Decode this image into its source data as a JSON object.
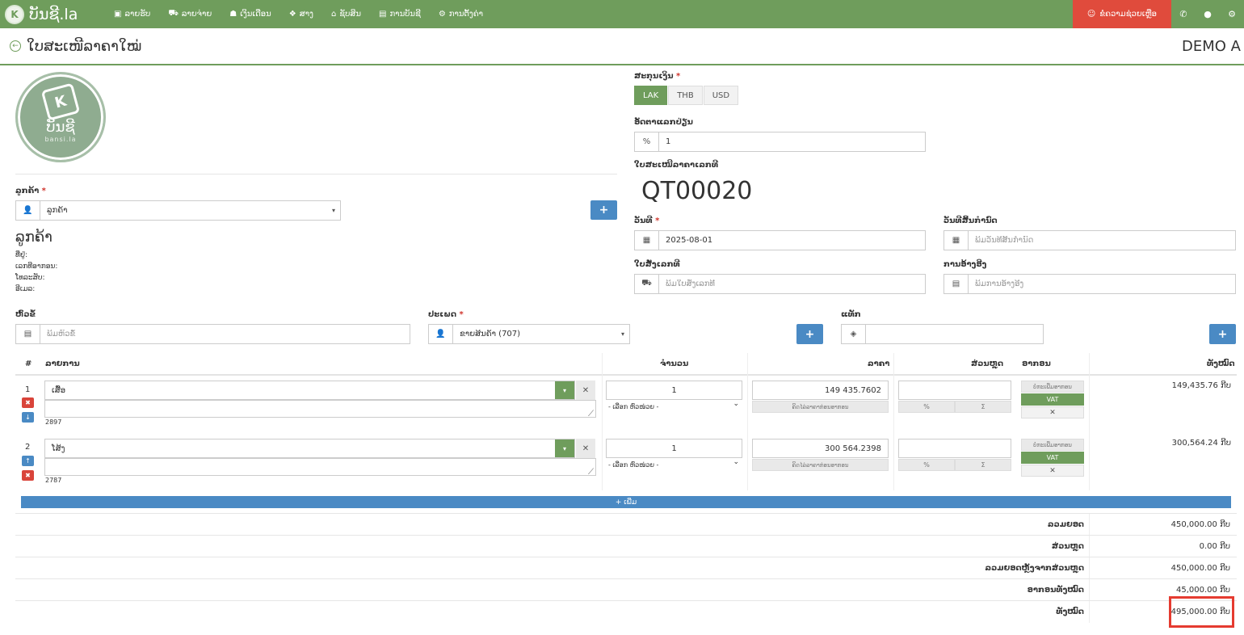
{
  "app": {
    "brand": "ບັນຊີ.la",
    "brand_logo": "K"
  },
  "nav": [
    {
      "icon": "money-icon",
      "glyph": "▣",
      "label": "ລາຍຮັບ"
    },
    {
      "icon": "cart-icon",
      "glyph": "⛟",
      "label": "ລາຍຈ່າຍ"
    },
    {
      "icon": "users-icon",
      "glyph": "☗",
      "label": "ເງິນເດືອນ"
    },
    {
      "icon": "cubes-icon",
      "glyph": "❖",
      "label": "ສາງ"
    },
    {
      "icon": "bank-icon",
      "glyph": "⌂",
      "label": "ຊັບສິນ"
    },
    {
      "icon": "book-icon",
      "glyph": "▤",
      "label": "ການບັນຊີ"
    },
    {
      "icon": "cogs-icon",
      "glyph": "⚙",
      "label": "ການຕັ້ງຄ່າ"
    }
  ],
  "support": {
    "label": "ຂໍຄວາມຊ່ວຍເຫຼືອ"
  },
  "page": {
    "title": "ໃບສະເໜີລາຄາໃໝ່",
    "company": "DEMO A"
  },
  "logo": {
    "name": "ບັນຊີ",
    "sub": "bansi.la"
  },
  "currency": {
    "label": "ສະກຸນເງິນ",
    "options": [
      "LAK",
      "THB",
      "USD"
    ],
    "selected": "LAK"
  },
  "exchange": {
    "label": "ອັດຕາແລກປ່ຽນ",
    "addon": "%",
    "value": "1"
  },
  "quote": {
    "label": "ໃບສະເໜີລາຄາເລກທີ",
    "number": "QT00020"
  },
  "customer": {
    "label": "ລູກຄ້າ",
    "select_value": "ລູກຄ້າ",
    "name": "ລູກຄ້າ",
    "address": "ທີ່ຢູ່:",
    "tax_id": "ເລກທີອາກອນ:",
    "phone": "ໂທລະສັບ:",
    "email": "ອີເມລ:"
  },
  "date": {
    "label": "ວັນທີ",
    "value": "2025-08-01"
  },
  "expiry": {
    "label": "ວັນທີສິ້ນກຳນົດ",
    "placeholder": "ພິມວັນທີສິ້ນກຳນົດ"
  },
  "po": {
    "label": "ໃບສັ່ງເລກທີ",
    "placeholder": "ພິມໃບສັ່ງເລກທີ"
  },
  "reference": {
    "label": "ການອ້າງອີງ",
    "placeholder": "ພິມການອ້າງອີງ"
  },
  "subject": {
    "label": "ຫົວຂໍ້",
    "placeholder": "ພິມຫົວຂໍ້"
  },
  "type": {
    "label": "ປະເພດ",
    "value": "ຂາຍສິນຄ້າ (707)"
  },
  "tags": {
    "label": "ແທັກ"
  },
  "table": {
    "headers": {
      "num": "#",
      "item": "ລາຍການ",
      "qty": "ຈຳນວນ",
      "price": "ລາຄາ",
      "discount": "ສ່ວນຫຼຸດ",
      "tax": "ອາກອນ",
      "total": "ທັງໝົດ"
    },
    "unit_placeholder": "- ເລືອກ ຫົວໜ່ວຍ -",
    "price_note": "ຄິດໄລ່ລາຄາກ່ອນອາກອນ",
    "disc_pct": "%",
    "disc_sum": "Σ",
    "tax_top": "ບໍ່ກະເພີ່ມອາກອນ",
    "tax_vat": "VAT",
    "rows": [
      {
        "num": "1",
        "name": "ເສື້ອ",
        "code": "2897",
        "qty": "1",
        "price": "149 435.7602",
        "total": "149,435.76 ກີບ"
      },
      {
        "num": "2",
        "name": "ໂສ້ງ",
        "code": "2787",
        "qty": "1",
        "price": "300 564.2398",
        "total": "300,564.24 ກີບ"
      }
    ],
    "add_label": "+ ເພີ່ມ"
  },
  "summary": [
    {
      "label": "ລວມຍອດ",
      "value": "450,000.00 ກີບ"
    },
    {
      "label": "ສ່ວນຫຼຸດ",
      "value": "0.00 ກີບ"
    },
    {
      "label": "ລວມຍອດຫຼັງຈາກສ່ວນຫຼຸດ",
      "value": "450,000.00 ກີບ"
    },
    {
      "label": "ອາກອນທັງໝົດ",
      "value": "45,000.00 ກີບ"
    },
    {
      "label": "ທັງໝົດ",
      "value": "495,000.00 ກີບ"
    }
  ],
  "colors": {
    "primary": "#6f9d5c",
    "blue": "#4a8ac4",
    "red": "#e04b3c"
  }
}
